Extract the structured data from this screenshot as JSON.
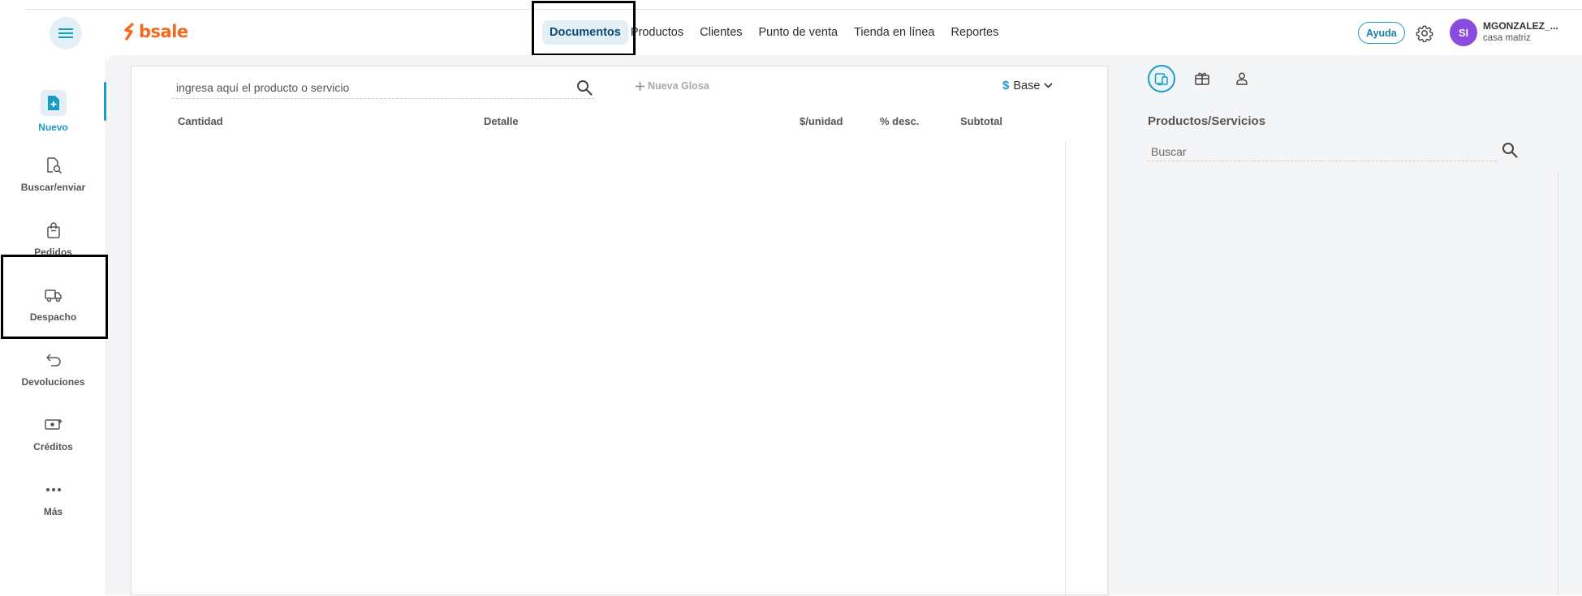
{
  "header": {
    "logo_text": "bsale",
    "nav": [
      {
        "label": "Documentos",
        "active": true
      },
      {
        "label": "Productos",
        "active": false
      },
      {
        "label": "Clientes",
        "active": false
      },
      {
        "label": "Punto de venta",
        "active": false
      },
      {
        "label": "Tienda en línea",
        "active": false
      },
      {
        "label": "Reportes",
        "active": false
      }
    ],
    "help_label": "Ayuda",
    "user": {
      "initials": "SI",
      "name": "MGONZALEZ_...",
      "branch": "casa matriz"
    }
  },
  "sidebar": {
    "items": [
      {
        "label": "Nuevo",
        "icon": "document-plus-icon",
        "active": true
      },
      {
        "label": "Buscar/enviar",
        "icon": "document-search-icon",
        "active": false
      },
      {
        "label": "Pedidos",
        "icon": "shopping-bag-icon",
        "active": false
      },
      {
        "label": "Despacho",
        "icon": "truck-icon",
        "active": false
      },
      {
        "label": "Devoluciones",
        "icon": "return-arrow-icon",
        "active": false
      },
      {
        "label": "Créditos",
        "icon": "cash-plus-icon",
        "active": false
      },
      {
        "label": "Más",
        "icon": "more-dots-icon",
        "active": false
      }
    ]
  },
  "document": {
    "search_placeholder": "ingresa aquí el producto o servicio",
    "new_glosa_label": "Nueva Glosa",
    "price_list": {
      "symbol": "$",
      "value": "Base"
    },
    "columns": [
      "Cantidad",
      "Detalle",
      "$/unidad",
      "% desc.",
      "Subtotal"
    ]
  },
  "right_panel": {
    "tabs": [
      {
        "icon": "device-icon",
        "active": true
      },
      {
        "icon": "gift-icon",
        "active": false
      },
      {
        "icon": "person-icon",
        "active": false
      }
    ],
    "title": "Productos/Servicios",
    "search_placeholder": "Buscar"
  },
  "colors": {
    "accent": "#1a9bc4",
    "brand": "#f26b1d",
    "avatar": "#8a4be0"
  }
}
